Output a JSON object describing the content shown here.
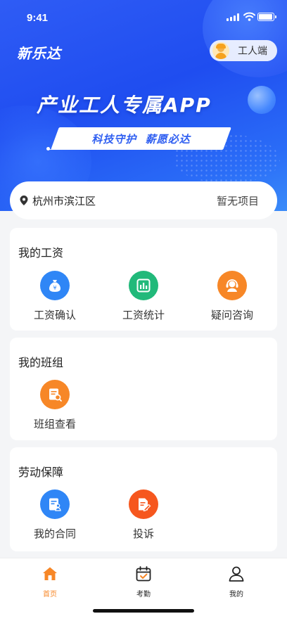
{
  "status_bar": {
    "time": "9:41"
  },
  "header": {
    "app_name": "新乐达",
    "role_label": "工人端",
    "slogan": "产业工人专属APP",
    "tagline": "科技守护  薪愿必达"
  },
  "location": {
    "city": "杭州市滨江区",
    "project": "暂无项目"
  },
  "sections": {
    "wage": {
      "title": "我的工资",
      "items": [
        {
          "label": "工资确认",
          "icon": "money-bag-icon"
        },
        {
          "label": "工资统计",
          "icon": "bar-chart-icon"
        },
        {
          "label": "疑问咨询",
          "icon": "headset-icon"
        }
      ]
    },
    "team": {
      "title": "我的班组",
      "items": [
        {
          "label": "班组查看",
          "icon": "document-search-icon"
        }
      ]
    },
    "labor": {
      "title": "劳动保障",
      "items": [
        {
          "label": "我的合同",
          "icon": "contract-icon"
        },
        {
          "label": "投诉",
          "icon": "complaint-icon"
        }
      ]
    }
  },
  "tabs": [
    {
      "label": "首页",
      "icon": "home-icon",
      "active": true
    },
    {
      "label": "考勤",
      "icon": "calendar-check-icon",
      "active": false
    },
    {
      "label": "我的",
      "icon": "user-icon",
      "active": false
    }
  ],
  "colors": {
    "primary_blue": "#2f5cf5",
    "accent_orange": "#f78727",
    "icon_blue": "#2f86f6",
    "icon_green": "#21b97a",
    "icon_red_orange": "#f6571e"
  }
}
